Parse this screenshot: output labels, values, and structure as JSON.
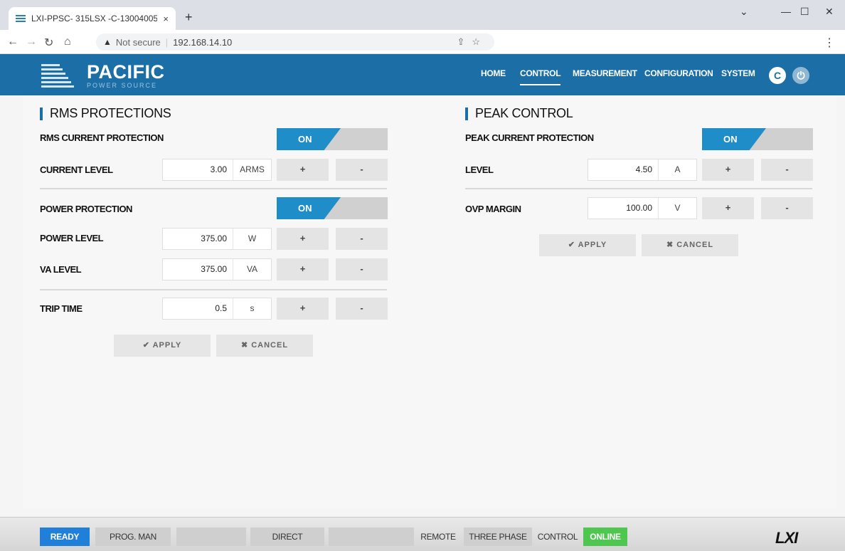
{
  "browser": {
    "tab_title": "LXI-PPSC- 315LSX -C-13004005",
    "tab_close": "×",
    "new_tab": "+",
    "address_warning": "Not secure",
    "address_url": "192.168.14.10",
    "window_minimize": "—",
    "window_maximize": "☐",
    "window_close": "✕",
    "window_dropdown": "⌄"
  },
  "header": {
    "brand": "PACIFIC",
    "brand_sub": "POWER SOURCE",
    "nav": [
      {
        "label": "HOME"
      },
      {
        "label": "CONTROL"
      },
      {
        "label": "MEASUREMENT"
      },
      {
        "label": "CONFIGURATION"
      },
      {
        "label": "SYSTEM"
      }
    ],
    "active_nav": "CONTROL"
  },
  "rms": {
    "title": "RMS PROTECTIONS",
    "current_protection_label": "RMS CURRENT PROTECTION",
    "current_protection_state": "ON",
    "current_level_label": "CURRENT LEVEL",
    "current_level_value": "3.00",
    "current_level_unit": "ARMS",
    "power_protection_label": "POWER PROTECTION",
    "power_protection_state": "ON",
    "power_level_label": "POWER LEVEL",
    "power_level_value": "375.00",
    "power_level_unit": "W",
    "va_level_label": "VA LEVEL",
    "va_level_value": "375.00",
    "va_level_unit": "VA",
    "trip_time_label": "TRIP TIME",
    "trip_time_value": "0.5",
    "trip_time_unit": "s",
    "plus": "+",
    "minus": "-",
    "apply": "✔ APPLY",
    "cancel": "✖ CANCEL"
  },
  "peak": {
    "title": "PEAK CONTROL",
    "protection_label": "PEAK CURRENT PROTECTION",
    "protection_state": "ON",
    "level_label": "LEVEL",
    "level_value": "4.50",
    "level_unit": "A",
    "ovp_label": "OVP MARGIN",
    "ovp_value": "100.00",
    "ovp_unit": "V",
    "plus": "+",
    "minus": "-",
    "apply": "✔ APPLY",
    "cancel": "✖ CANCEL"
  },
  "status": {
    "ready": "READY",
    "prog": "PROG. MAN",
    "blank1": "",
    "direct": "DIRECT",
    "blank2": "",
    "remote": "REMOTE",
    "three_phase": "THREE PHASE",
    "control": "CONTROL",
    "online": "ONLINE",
    "lxi": "LXI"
  },
  "colors": {
    "header_blue": "#1b6fa6",
    "toggle_on": "#1f8dc7",
    "ready": "#1f7fd9",
    "online": "#4fc64f"
  }
}
